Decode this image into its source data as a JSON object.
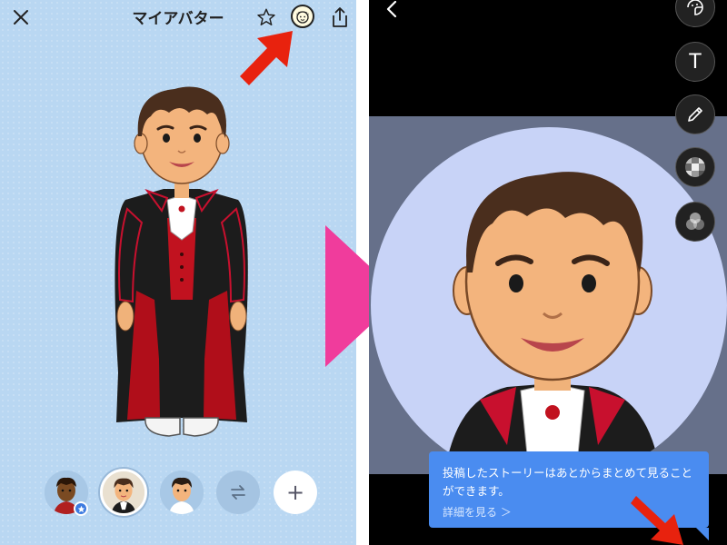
{
  "left_panel": {
    "title": "マイアバター",
    "icons": {
      "close": "close-icon",
      "favorite": "star-icon",
      "avatar_face": "avatar-face-icon",
      "share": "share-icon"
    },
    "carousel": {
      "items": [
        {
          "name": "avatar-thumb-1",
          "has_badge": true
        },
        {
          "name": "avatar-thumb-2",
          "selected": true
        },
        {
          "name": "avatar-thumb-3"
        }
      ],
      "swap_icon": "swap-icon",
      "add_label": "+"
    }
  },
  "right_panel": {
    "tools": [
      "sticker-icon",
      "text-icon",
      "pen-icon",
      "mosaic-icon",
      "filter-icon"
    ],
    "tools_text": "T",
    "tooltip": {
      "text": "投稿したストーリーはあとからまとめて見ることができます。",
      "link": "詳細を見る ＞"
    }
  },
  "colors": {
    "left_bg": "#b9d7f2",
    "arrow_red": "#e8220e",
    "center_arrow_pink": "#f03c9c",
    "tooltip_blue": "#4a8cf0",
    "story_circle": "#c8d3f7"
  }
}
